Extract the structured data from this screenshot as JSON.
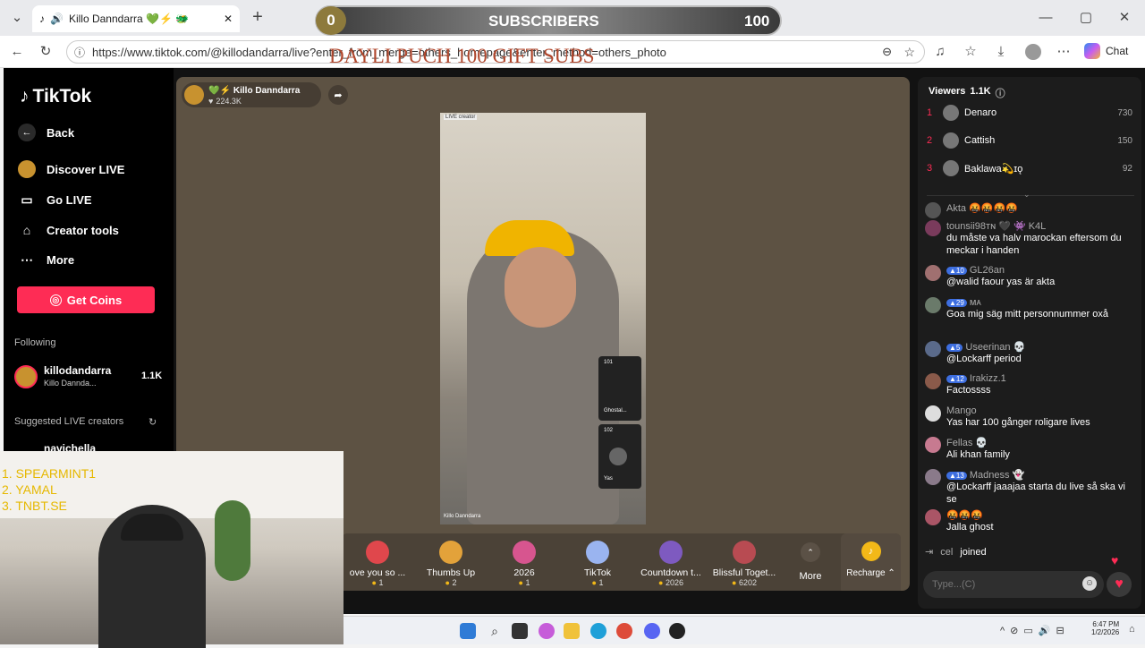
{
  "browser": {
    "tab_title": "Killo Danndarra 💚⚡ 🐲",
    "url": "https://www.tiktok.com/@killodandarra/live?enter_from_merge=others_homepage&enter_method=others_photo",
    "chat_label": "Chat"
  },
  "overlay": {
    "sub_count": "0",
    "sub_label": "SUBSCRIBERS",
    "sub_goal": "100",
    "daily_push": "DAYLI PUCH 100 GIFT SUBS",
    "leaderboard": [
      "1.  SPEARMINT1",
      "2.  YAMAL",
      "3.  TNBT.SE"
    ]
  },
  "sidebar": {
    "logo": "TikTok",
    "back": "Back",
    "discover": "Discover LIVE",
    "golive": "Go LIVE",
    "creator_tools": "Creator tools",
    "more": "More",
    "get_coins": "Get Coins",
    "following_title": "Following",
    "following_user": "killodandarra",
    "following_sub": "Killo Dannda...",
    "following_count": "1.1K",
    "suggested_title": "Suggested LIVE creators",
    "suggested_user": "navichella"
  },
  "stream": {
    "host_name": "Killo Danndarra",
    "host_likes": "224.3K",
    "live_tag": "LIVE creator",
    "guest1_count": "101",
    "guest1_name": "Ghostal...",
    "guest2_count": "102",
    "guest2_name": "Yas",
    "bottom_name": "Killo Danndarra"
  },
  "gifts": [
    {
      "name": "ove you so ...",
      "price": "1",
      "color": "#e0474c"
    },
    {
      "name": "Thumbs Up",
      "price": "2",
      "color": "#e3a23a"
    },
    {
      "name": "2026",
      "price": "1",
      "color": "#d7558f"
    },
    {
      "name": "TikTok",
      "price": "1",
      "color": "#9ab4f0"
    },
    {
      "name": "Countdown t...",
      "price": "2026",
      "color": "#7e5ac0"
    },
    {
      "name": "Blissful Toget...",
      "price": "6202",
      "color": "#b84b52"
    }
  ],
  "gift_more": "More",
  "recharge": "Recharge",
  "viewers": {
    "title": "Viewers",
    "count": "1.1K",
    "top": [
      {
        "rank": "1",
        "name": "Denaro",
        "score": "730"
      },
      {
        "rank": "2",
        "name": "Cattish",
        "score": "150"
      },
      {
        "rank": "3",
        "name": "Baklawa💫ɪǫ",
        "score": "92"
      }
    ]
  },
  "chat": [
    {
      "user": "Akta 🤬🤬🤬🤬",
      "text": "",
      "color": "#555"
    },
    {
      "user": "tounsii98ᴛɴ 🖤 👾 K4L",
      "text": "du måste va halv marockan eftersom du meckar i handen",
      "color": "#7a3b5c"
    },
    {
      "user": "GL26an",
      "level": "10",
      "text": "@walid faour yas är akta",
      "color": "#a07070"
    },
    {
      "user": "ᴍᴀ",
      "level": "29",
      "text": "Goa mig säg mitt personnummer oxå",
      "color": "#6a7a6a"
    },
    {
      "user": "Useerinan 💀",
      "level": "5",
      "text": "@Lockarff period",
      "color": "#5a6a8a"
    },
    {
      "user": "Irakizz.1",
      "level": "12",
      "text": "Factossss",
      "color": "#8a5a4a"
    },
    {
      "user": "Mango",
      "text": "Yas har 100 gånger roligare lives",
      "color": "#ddd"
    },
    {
      "user": "Fellas 💀",
      "text": "Ali khan family",
      "color": "#c77a90"
    },
    {
      "user": "Madness 👻",
      "level": "13",
      "text": "@Lockarff jaaajaa starta du live så ska vi se",
      "color": "#8a7a8a"
    },
    {
      "user": "🤬🤬🤬",
      "text": "Jalla ghost",
      "color": "#aa5566"
    }
  ],
  "joined": {
    "user": "cel",
    "text": "joined"
  },
  "chat_input_placeholder": "Type...(C)",
  "taskbar": {
    "time": "6:47 PM",
    "date": "1/2/2026"
  }
}
